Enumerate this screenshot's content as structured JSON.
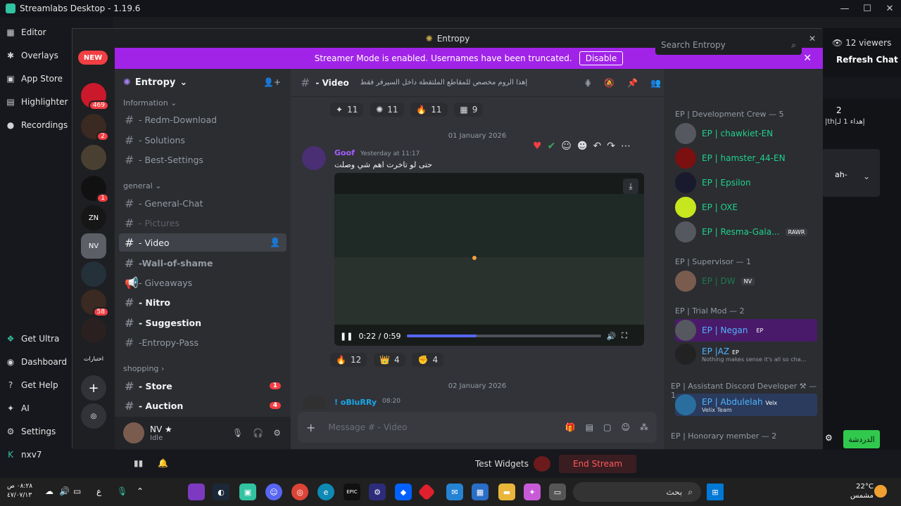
{
  "streamlabs": {
    "title": "Streamlabs Desktop - 1.19.6",
    "menu": [
      {
        "icon": "editor-icon",
        "label": "Editor"
      },
      {
        "icon": "overlays-icon",
        "label": "Overlays"
      },
      {
        "icon": "app-store-icon",
        "label": "App Store"
      },
      {
        "icon": "highlighter-icon",
        "label": "Highlighter"
      },
      {
        "icon": "recordings-icon",
        "label": "Recordings"
      }
    ],
    "bottom_menu": [
      {
        "label": "Get Ultra"
      },
      {
        "label": "Dashboard"
      },
      {
        "label": "Get Help"
      },
      {
        "label": "AI"
      },
      {
        "label": "Settings"
      },
      {
        "label": "nxv7"
      }
    ],
    "viewers": "12 viewers",
    "refresh_chat": "Refresh Chat",
    "test_widgets": "Test Widgets",
    "end_stream": "End Stream",
    "chat_button": "الدردشة",
    "side_count": "2",
    "side_text": "|th|إهداء 1 لـ",
    "side_text2": "ah-"
  },
  "discord": {
    "window_title": "Entropy",
    "banner_text": "Streamer Mode is enabled. Usernames have been truncated.",
    "banner_button": "Disable",
    "server_name": "Entropy",
    "new_badge": "NEW",
    "badges": [
      "469",
      "2",
      "1",
      "58"
    ],
    "server_label": "اختبارات",
    "categories": {
      "information": "Information",
      "general": "general",
      "shopping": "shopping"
    },
    "channels": [
      "- Redm-Download",
      "- Solutions",
      "- Best-Settings",
      "- General-Chat",
      "- Pictures",
      "- Video",
      "-Wall-of-shame",
      "- Giveaways",
      "- Nitro",
      "- Suggestion",
      "-Entropy-Pass",
      "- Store",
      "- Auction"
    ],
    "channel_badges": [
      "1",
      "4"
    ],
    "user": {
      "name": "NV ★",
      "status": "Idle"
    },
    "header": {
      "channel": "- Video",
      "topic": "إهذا الروم مخصص للمقاطع الملتقطة داخل السيرفر فقط",
      "search": "Search Entropy"
    },
    "top_reactions": [
      "11",
      "11",
      "11",
      "9"
    ],
    "date1": "01 January 2026",
    "date2": "02 January 2026",
    "message": {
      "author": "Goof",
      "time": "Yesterday at 11:17",
      "text": "حتى لو تاخرت اهم شي وصلت",
      "video_time": "0:22 / 0:59",
      "progress": 0.36
    },
    "reactions": [
      "12",
      "4",
      "4"
    ],
    "message2": {
      "author": "! oBluRRy",
      "time": "08:20"
    },
    "composer_placeholder": "Message # - Video",
    "members": {
      "groups": [
        "EP | Development Crew — 5",
        "EP | Supervisor — 1",
        "EP | Trial Mod — 2",
        "EP | Assistant Discord Developer ⚒ — 1",
        "EP | Honorary member — 2"
      ],
      "list": [
        {
          "name": "EP | chawkiet-EN"
        },
        {
          "name": "EP | hamster_44-EN"
        },
        {
          "name": "EP | Epsilon"
        },
        {
          "name": "EP | OXE"
        },
        {
          "name": "EP | Resma-Gala...",
          "tag": "RAWR"
        },
        {
          "name": "EP | DW",
          "tag": "NV"
        },
        {
          "name": "EP | Negan",
          "tag": "EP"
        },
        {
          "name": "EP |AZ",
          "tag": "EP",
          "sub": "Nothing makes sense it's all so cha..."
        },
        {
          "name": "EP | Abdulelah",
          "tag": "Velx",
          "sub": "Velix Team"
        }
      ]
    }
  },
  "taskbar": {
    "time": "٠٨:٢٨ ص",
    "date": "٤٧/٠٧/١٣",
    "search": "بحث",
    "weather_temp": "22°C",
    "weather_text": "مشمس",
    "lang": "ع"
  }
}
